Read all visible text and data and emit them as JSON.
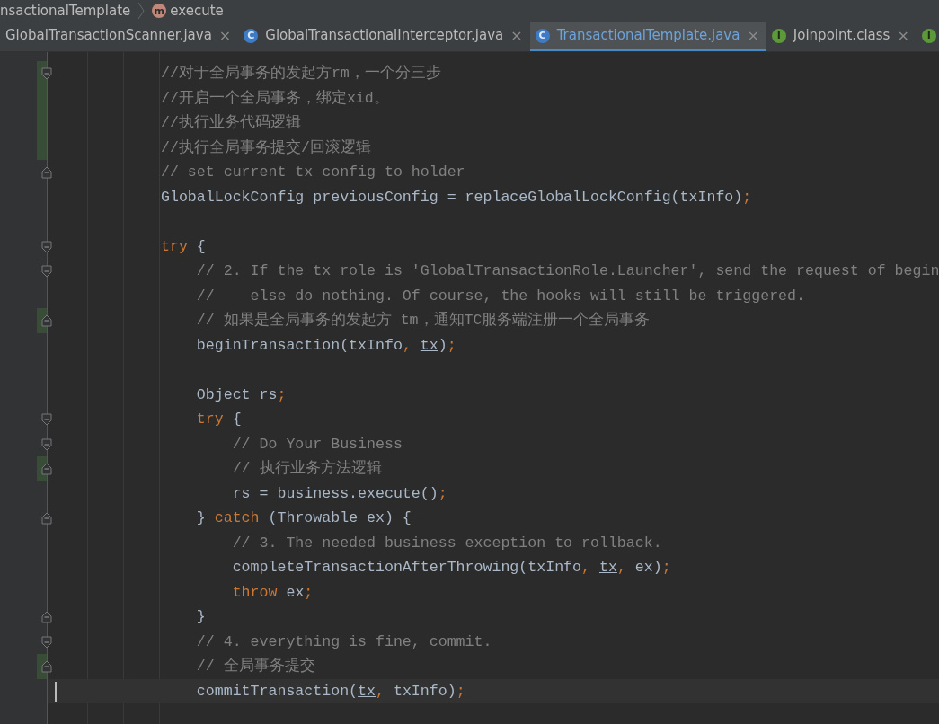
{
  "breadcrumb": [
    {
      "kind": "class",
      "label": "nsactionalTemplate"
    },
    {
      "kind": "method",
      "icon_text": "m",
      "label": "execute"
    }
  ],
  "tabs": [
    {
      "label": "GlobalTransactionScanner.java",
      "kind": "plain",
      "selected": false,
      "close": "×"
    },
    {
      "label": "GlobalTransactionalInterceptor.java",
      "kind": "class",
      "icon_text": "C",
      "selected": false,
      "close": "×"
    },
    {
      "label": "TransactionalTemplate.java",
      "kind": "class",
      "icon_text": "C",
      "selected": true,
      "close": "×"
    },
    {
      "label": "Joinpoint.class",
      "kind": "interface",
      "icon_text": "I",
      "selected": false,
      "close": "×"
    },
    {
      "kind": "interface",
      "icon_text": "I",
      "selected": false
    }
  ],
  "lines": [
    {
      "fold_open": true,
      "fold_close": false,
      "changed": true,
      "current": false,
      "tokens": [
        {
          "kind": "comment",
          "text": "//对于全局事务的发起方rm，一个分三步"
        }
      ]
    },
    {
      "fold_open": false,
      "fold_close": false,
      "changed": true,
      "current": false,
      "tokens": [
        {
          "kind": "comment",
          "text": "//开启一个全局事务，绑定xid。"
        }
      ]
    },
    {
      "fold_open": false,
      "fold_close": false,
      "changed": true,
      "current": false,
      "tokens": [
        {
          "kind": "comment",
          "text": "//执行业务代码逻辑"
        }
      ]
    },
    {
      "fold_open": false,
      "fold_close": false,
      "changed": true,
      "current": false,
      "tokens": [
        {
          "kind": "comment",
          "text": "//执行全局事务提交/回滚逻辑"
        }
      ]
    },
    {
      "fold_open": false,
      "fold_close": true,
      "changed": false,
      "current": false,
      "tokens": [
        {
          "kind": "comment",
          "text": "// set current tx config to holder"
        }
      ]
    },
    {
      "fold_open": false,
      "fold_close": false,
      "changed": false,
      "current": false,
      "tokens": [
        {
          "kind": "plain",
          "text": "GlobalLockConfig previousConfig = replaceGlobalLockConfig(txInfo)"
        },
        {
          "kind": "punct",
          "text": ";"
        }
      ]
    },
    {
      "fold_open": false,
      "fold_close": false,
      "changed": false,
      "current": false
    },
    {
      "fold_open": true,
      "fold_close": false,
      "changed": false,
      "current": false,
      "tokens": [
        {
          "kind": "keyword",
          "text": "try"
        },
        {
          "kind": "plain",
          "text": " {"
        }
      ]
    },
    {
      "fold_open": true,
      "fold_close": false,
      "changed": false,
      "current": false,
      "tokens": [
        {
          "kind": "comment",
          "text": "    // 2. If the tx role is 'GlobalTransactionRole.Launcher', send the request of begin"
        }
      ]
    },
    {
      "fold_open": false,
      "fold_close": false,
      "changed": false,
      "current": false,
      "tokens": [
        {
          "kind": "comment",
          "text": "    //    else do nothing. Of course, the hooks will still be triggered."
        }
      ]
    },
    {
      "fold_open": false,
      "fold_close": true,
      "changed": true,
      "current": false,
      "tokens": [
        {
          "kind": "comment",
          "text": "    // 如果是全局事务的发起方 tm，通知TC服务端注册一个全局事务"
        }
      ]
    },
    {
      "fold_open": false,
      "fold_close": false,
      "changed": false,
      "current": false,
      "tokens": [
        {
          "kind": "plain",
          "text": "    beginTransaction(txInfo"
        },
        {
          "kind": "punct",
          "text": ", "
        },
        {
          "kind": "param",
          "text": "tx"
        },
        {
          "kind": "plain",
          "text": ")"
        },
        {
          "kind": "punct",
          "text": ";"
        }
      ]
    },
    {
      "fold_open": false,
      "fold_close": false,
      "changed": false,
      "current": false
    },
    {
      "fold_open": false,
      "fold_close": false,
      "changed": false,
      "current": false,
      "tokens": [
        {
          "kind": "plain",
          "text": "    Object rs"
        },
        {
          "kind": "punct",
          "text": ";"
        }
      ]
    },
    {
      "fold_open": true,
      "fold_close": false,
      "changed": false,
      "current": false,
      "tokens": [
        {
          "kind": "keyword",
          "text": "    try"
        },
        {
          "kind": "plain",
          "text": " {"
        }
      ]
    },
    {
      "fold_open": true,
      "fold_close": false,
      "changed": false,
      "current": false,
      "tokens": [
        {
          "kind": "comment",
          "text": "        // Do Your Business"
        }
      ]
    },
    {
      "fold_open": false,
      "fold_close": true,
      "changed": true,
      "current": false,
      "tokens": [
        {
          "kind": "comment",
          "text": "        // 执行业务方法逻辑"
        }
      ]
    },
    {
      "fold_open": false,
      "fold_close": false,
      "changed": false,
      "current": false,
      "tokens": [
        {
          "kind": "plain",
          "text": "        rs = business.execute()"
        },
        {
          "kind": "punct",
          "text": ";"
        }
      ]
    },
    {
      "fold_open": false,
      "fold_close": true,
      "changed": false,
      "current": false,
      "tokens": [
        {
          "kind": "plain",
          "text": "    } "
        },
        {
          "kind": "keyword",
          "text": "catch"
        },
        {
          "kind": "plain",
          "text": " (Throwable ex) {"
        }
      ]
    },
    {
      "fold_open": false,
      "fold_close": false,
      "changed": false,
      "current": false,
      "tokens": [
        {
          "kind": "comment",
          "text": "        // 3. The needed business exception to rollback."
        }
      ]
    },
    {
      "fold_open": false,
      "fold_close": false,
      "changed": false,
      "current": false,
      "tokens": [
        {
          "kind": "plain",
          "text": "        completeTransactionAfterThrowing(txInfo"
        },
        {
          "kind": "punct",
          "text": ", "
        },
        {
          "kind": "param",
          "text": "tx"
        },
        {
          "kind": "punct",
          "text": ", "
        },
        {
          "kind": "plain",
          "text": "ex)"
        },
        {
          "kind": "punct",
          "text": ";"
        }
      ]
    },
    {
      "fold_open": false,
      "fold_close": false,
      "changed": false,
      "current": false,
      "tokens": [
        {
          "kind": "keyword",
          "text": "        throw "
        },
        {
          "kind": "plain",
          "text": "ex"
        },
        {
          "kind": "punct",
          "text": ";"
        }
      ]
    },
    {
      "fold_open": false,
      "fold_close": true,
      "changed": false,
      "current": false,
      "tokens": [
        {
          "kind": "plain",
          "text": "    }"
        }
      ]
    },
    {
      "fold_open": true,
      "fold_close": false,
      "changed": false,
      "current": false,
      "tokens": [
        {
          "kind": "comment",
          "text": "    // 4. everything is fine, commit."
        }
      ]
    },
    {
      "fold_open": false,
      "fold_close": true,
      "changed": true,
      "current": false,
      "tokens": [
        {
          "kind": "comment",
          "text": "    // 全局事务提交"
        }
      ]
    },
    {
      "fold_open": false,
      "fold_close": false,
      "changed": false,
      "current": true,
      "tokens": [
        {
          "kind": "plain",
          "text": "    commitTransaction("
        },
        {
          "kind": "param",
          "text": "tx"
        },
        {
          "kind": "punct",
          "text": ", "
        },
        {
          "kind": "plain",
          "text": "txInfo)"
        },
        {
          "kind": "punct",
          "text": ";"
        }
      ]
    },
    {
      "fold_open": false,
      "fold_close": false,
      "changed": false,
      "current": false
    }
  ]
}
